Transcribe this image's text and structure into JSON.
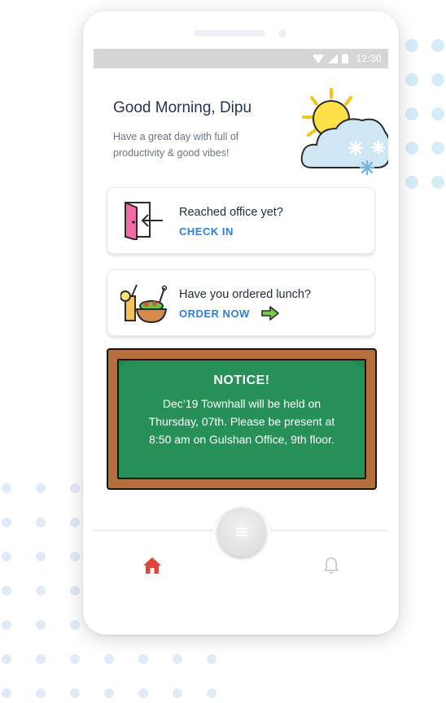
{
  "status_bar": {
    "time": "12:30"
  },
  "greeting": {
    "title": "Good Morning, Dipu",
    "subtitle": "Have a great day with full of productivity & good vibes!"
  },
  "cards": [
    {
      "title": "Reached office yet?",
      "action": "CHECK IN",
      "icon": "door-exit-icon"
    },
    {
      "title": "Have you ordered lunch?",
      "action": "ORDER NOW",
      "icon": "lunch-bowl-icon"
    }
  ],
  "notice": {
    "title": "NOTICE!",
    "body": "Dec’19 Townhall will be held on Thursday, 07th. Please be present at 8:50 am on Gulshan Office, 9th floor."
  },
  "nav": {
    "items": [
      "home-icon",
      "menu-icon",
      "bell-icon"
    ],
    "active": "home"
  },
  "colors": {
    "accent_blue": "#2f7fd8",
    "board_green": "#1c8b50",
    "board_frame": "#b56f3d",
    "home_active": "#e0453a"
  }
}
